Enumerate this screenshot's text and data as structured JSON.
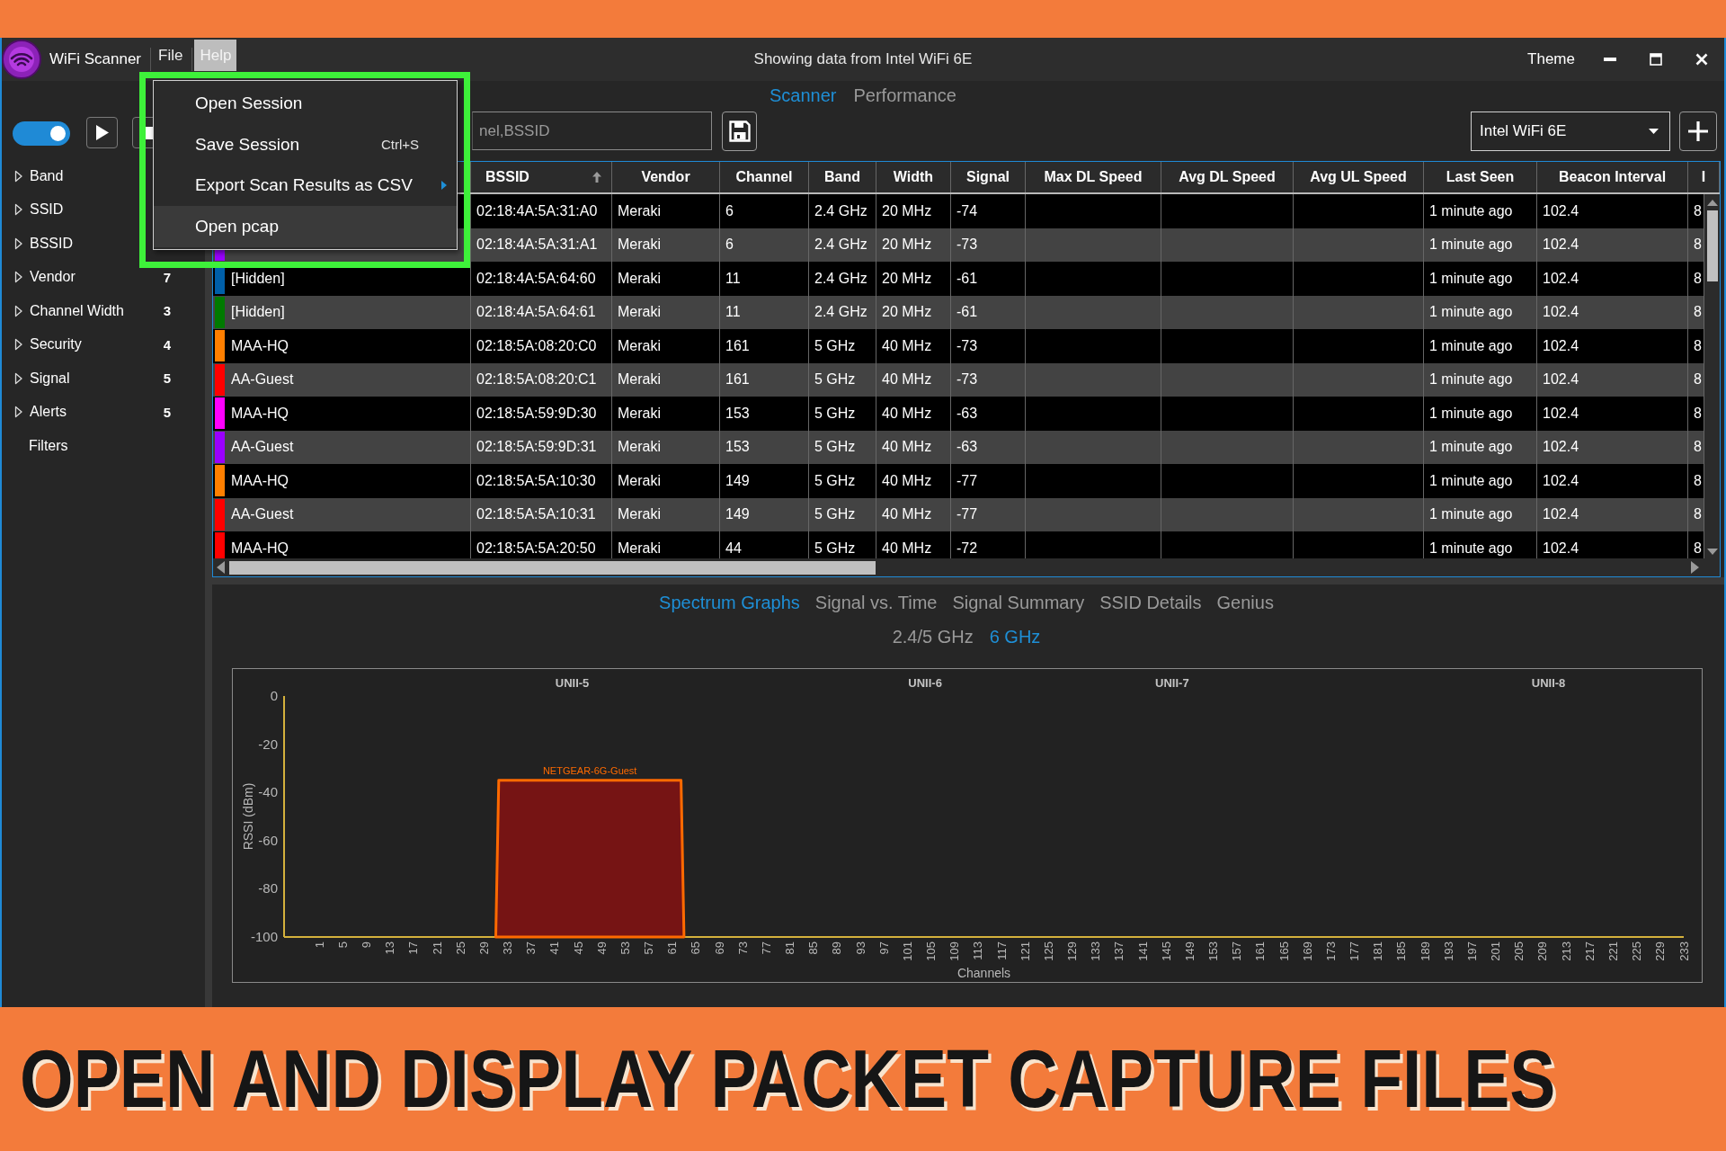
{
  "window": {
    "app_name": "WiFi Scanner",
    "title": "Showing data from Intel WiFi 6E",
    "theme_label": "Theme"
  },
  "menu_bar": [
    {
      "label": "File",
      "selected": false
    },
    {
      "label": "Help",
      "selected": true
    }
  ],
  "open_menu": {
    "highlighted": true,
    "items": [
      {
        "label": "Open Session",
        "kind": "command",
        "selected": false
      },
      {
        "label": "Save Session",
        "kind": "command",
        "shortcut": "Ctrl+S",
        "selected": false
      },
      {
        "label": "Export Scan Results as CSV",
        "kind": "submenu",
        "selected": false
      },
      {
        "label": "Open pcap",
        "kind": "command",
        "selected": true
      }
    ]
  },
  "view_tabs": [
    {
      "label": "Scanner",
      "selected": true
    },
    {
      "label": "Performance",
      "selected": false
    }
  ],
  "toolbar": {
    "scanning": {
      "on": true
    },
    "search": {
      "placeholder": "nel,BSSID"
    },
    "adapter": {
      "value": "Intel WiFi 6E"
    }
  },
  "sidebar": {
    "filters": [
      {
        "label": "Band",
        "expanded": false
      },
      {
        "label": "SSID",
        "expanded": false
      },
      {
        "label": "BSSID",
        "expanded": false
      },
      {
        "label": "Vendor",
        "count": "7",
        "expanded": false
      },
      {
        "label": "Channel Width",
        "count": "3",
        "expanded": false
      },
      {
        "label": "Security",
        "count": "4",
        "expanded": false
      },
      {
        "label": "Signal",
        "count": "5",
        "expanded": false
      },
      {
        "label": "Alerts",
        "count": "5",
        "expanded": false
      }
    ],
    "footer": "Filters"
  },
  "table": {
    "columns": [
      {
        "label": "BSSID",
        "sorted": true
      },
      {
        "label": "Vendor",
        "sorted": false
      },
      {
        "label": "Channel",
        "sorted": false
      },
      {
        "label": "Band",
        "sorted": false
      },
      {
        "label": "Width",
        "sorted": false
      },
      {
        "label": "Signal",
        "sorted": false
      },
      {
        "label": "Max DL Speed",
        "sorted": false
      },
      {
        "label": "Avg DL Speed",
        "sorted": false
      },
      {
        "label": "Avg UL Speed",
        "sorted": false
      },
      {
        "label": "Last Seen",
        "sorted": false
      },
      {
        "label": "Beacon Interval",
        "sorted": false
      },
      {
        "label": "I",
        "sorted": false
      }
    ],
    "rows": [
      {
        "bssid": "02:18:4A:5A:31:A0",
        "vendor": "Meraki",
        "channel": "6",
        "band": "2.4 GHz",
        "width": "20 MHz",
        "signal": "-74",
        "last_seen": "1 minute ago",
        "beacon_interval": "102.4",
        "column_13": "8"
      },
      {
        "color": "#9a00ff",
        "bssid": "02:18:4A:5A:31:A1",
        "vendor": "Meraki",
        "channel": "6",
        "band": "2.4 GHz",
        "width": "20 MHz",
        "signal": "-73",
        "last_seen": "1 minute ago",
        "beacon_interval": "102.4",
        "column_13": "8"
      },
      {
        "color": "#005fa8",
        "ssid": "[Hidden]",
        "bssid": "02:18:4A:5A:64:60",
        "vendor": "Meraki",
        "channel": "11",
        "band": "2.4 GHz",
        "width": "20 MHz",
        "signal": "-61",
        "last_seen": "1 minute ago",
        "beacon_interval": "102.4",
        "column_13": "8"
      },
      {
        "color": "#007a00",
        "ssid": "[Hidden]",
        "bssid": "02:18:4A:5A:64:61",
        "vendor": "Meraki",
        "channel": "11",
        "band": "2.4 GHz",
        "width": "20 MHz",
        "signal": "-61",
        "last_seen": "1 minute ago",
        "beacon_interval": "102.4",
        "column_13": "8"
      },
      {
        "color": "#ff7f00",
        "ssid": "MAA-HQ",
        "bssid": "02:18:5A:08:20:C0",
        "vendor": "Meraki",
        "channel": "161",
        "band": "5 GHz",
        "width": "40 MHz",
        "signal": "-73",
        "last_seen": "1 minute ago",
        "beacon_interval": "102.4",
        "column_13": "8"
      },
      {
        "color": "#ff0000",
        "ssid": "AA-Guest",
        "bssid": "02:18:5A:08:20:C1",
        "vendor": "Meraki",
        "channel": "161",
        "band": "5 GHz",
        "width": "40 MHz",
        "signal": "-73",
        "last_seen": "1 minute ago",
        "beacon_interval": "102.4",
        "column_13": "8"
      },
      {
        "color": "#ff00ff",
        "ssid": "MAA-HQ",
        "bssid": "02:18:5A:59:9D:30",
        "vendor": "Meraki",
        "channel": "153",
        "band": "5 GHz",
        "width": "40 MHz",
        "signal": "-63",
        "last_seen": "1 minute ago",
        "beacon_interval": "102.4",
        "column_13": "8"
      },
      {
        "color": "#9a00ff",
        "ssid": "AA-Guest",
        "bssid": "02:18:5A:59:9D:31",
        "vendor": "Meraki",
        "channel": "153",
        "band": "5 GHz",
        "width": "40 MHz",
        "signal": "-63",
        "last_seen": "1 minute ago",
        "beacon_interval": "102.4",
        "column_13": "8"
      },
      {
        "color": "#ff7f00",
        "ssid": "MAA-HQ",
        "bssid": "02:18:5A:5A:10:30",
        "vendor": "Meraki",
        "channel": "149",
        "band": "5 GHz",
        "width": "40 MHz",
        "signal": "-77",
        "last_seen": "1 minute ago",
        "beacon_interval": "102.4",
        "column_13": "8"
      },
      {
        "color": "#ff0000",
        "ssid": "AA-Guest",
        "bssid": "02:18:5A:5A:10:31",
        "vendor": "Meraki",
        "channel": "149",
        "band": "5 GHz",
        "width": "40 MHz",
        "signal": "-77",
        "last_seen": "1 minute ago",
        "beacon_interval": "102.4",
        "column_13": "8"
      },
      {
        "color": "#ff0000",
        "ssid": "MAA-HQ",
        "bssid": "02:18:5A:5A:20:50",
        "vendor": "Meraki",
        "channel": "44",
        "band": "5 GHz",
        "width": "40 MHz",
        "signal": "-72",
        "last_seen": "1 minute ago",
        "beacon_interval": "102.4",
        "column_13": "8"
      }
    ]
  },
  "spectrum": {
    "tabs": [
      {
        "label": "Spectrum Graphs",
        "selected": true
      },
      {
        "label": "Signal vs. Time",
        "selected": false
      },
      {
        "label": "Signal Summary",
        "selected": false
      },
      {
        "label": "SSID Details",
        "selected": false
      },
      {
        "label": "Genius",
        "selected": false
      }
    ],
    "band_tabs": [
      {
        "label": "2.4/5 GHz",
        "selected": false
      },
      {
        "label": "6 GHz",
        "selected": true
      }
    ],
    "chart_data": {
      "type": "area",
      "xlabel": "Channels",
      "ylabel": "RSSI (dBm)",
      "x": [
        31,
        31.5,
        62.5,
        63
      ],
      "series": [
        {
          "name": "NETGEAR-6G-Guest",
          "color": "#ff6a00",
          "values": [
            -100,
            -35,
            -35,
            -100
          ]
        }
      ],
      "xlim": [
        -5,
        233
      ],
      "ylim": [
        -100,
        0
      ],
      "xticks": [
        1,
        5,
        9,
        13,
        17,
        21,
        25,
        29,
        33,
        37,
        41,
        45,
        49,
        53,
        57,
        61,
        65,
        69,
        73,
        77,
        81,
        85,
        89,
        93,
        97,
        101,
        105,
        109,
        113,
        117,
        121,
        125,
        129,
        133,
        137,
        141,
        145,
        149,
        153,
        157,
        161,
        165,
        169,
        173,
        177,
        181,
        185,
        189,
        193,
        197,
        201,
        205,
        209,
        213,
        217,
        221,
        225,
        229,
        233
      ],
      "yticks": [
        0,
        -20,
        -40,
        -60,
        -80,
        -100
      ],
      "annotations": [
        "UNII-5",
        "UNII-6",
        "UNII-7",
        "UNII-8"
      ]
    }
  },
  "banner": {
    "headline": "OPEN AND DISPLAY PACKET CAPTURE FILES"
  }
}
